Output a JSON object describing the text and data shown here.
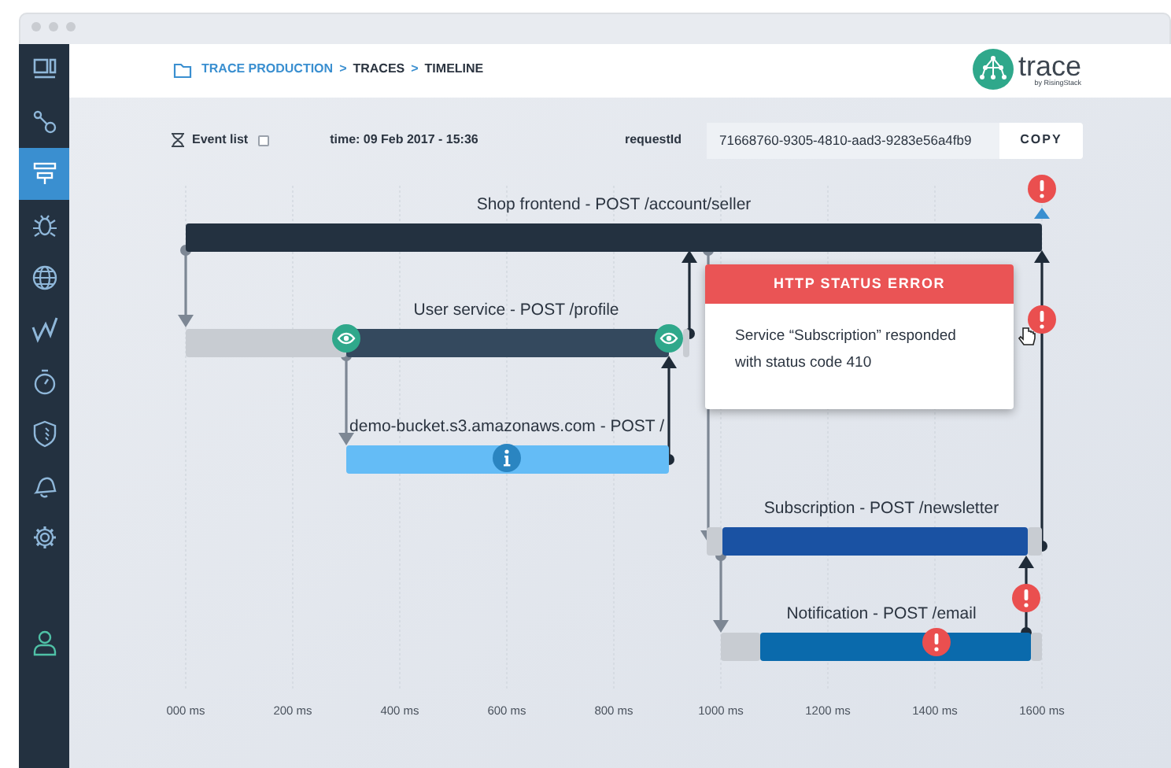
{
  "sidebar": {
    "items": [
      {
        "selected": false
      },
      {
        "selected": false
      },
      {
        "selected": true
      },
      {
        "selected": false
      },
      {
        "selected": false
      },
      {
        "selected": false
      },
      {
        "selected": false
      },
      {
        "selected": false
      },
      {
        "selected": false
      },
      {
        "selected": false
      },
      {
        "selected": false
      }
    ]
  },
  "breadcrumb": [
    {
      "label": "TRACE PRODUCTION",
      "kind": "link"
    },
    {
      "label": ">",
      "kind": "separator"
    },
    {
      "label": "TRACES",
      "kind": "crumb"
    },
    {
      "label": ">",
      "kind": "separator"
    },
    {
      "label": "TIMELINE",
      "kind": "crumb"
    }
  ],
  "logo": {
    "name": "trace",
    "tagline": "by RisingStack"
  },
  "toolbar": {
    "event_list": {
      "label": "Event list",
      "checked": false
    },
    "time": "time: 09 Feb 2017 - 15:36",
    "request_label": "requestId",
    "request_id": "71668760-9305-4810-aad3-9283e56a4fb9",
    "copy_button": "COPY"
  },
  "spans": [
    {
      "label": "Shop frontend - POST /account/seller",
      "color": "#233140",
      "markers": [
        {
          "kind": "error"
        }
      ]
    },
    {
      "label": "User service - POST /profile",
      "color": "#34495e",
      "markers": [
        {
          "kind": "eye"
        },
        {
          "kind": "eye"
        }
      ]
    },
    {
      "label": "demo-bucket.s3.amazonaws.com - POST /",
      "color": "#64bcf6",
      "markers": [
        {
          "kind": "info"
        }
      ]
    },
    {
      "label": "Subscription - POST /newsletter",
      "color": "#1a52a3"
    },
    {
      "label": "Notification - POST /email",
      "color": "#0a6aac",
      "markers": [
        {
          "kind": "error"
        },
        {
          "kind": "error"
        }
      ]
    }
  ],
  "tooltip": {
    "title": "HTTP STATUS ERROR",
    "body": "Service “Subscription” responded with status code 410"
  },
  "axis": [
    "000 ms",
    "200 ms",
    "400 ms",
    "600 ms",
    "800 ms",
    "1000 ms",
    "1200 ms",
    "1400 ms",
    "1600 ms"
  ]
}
